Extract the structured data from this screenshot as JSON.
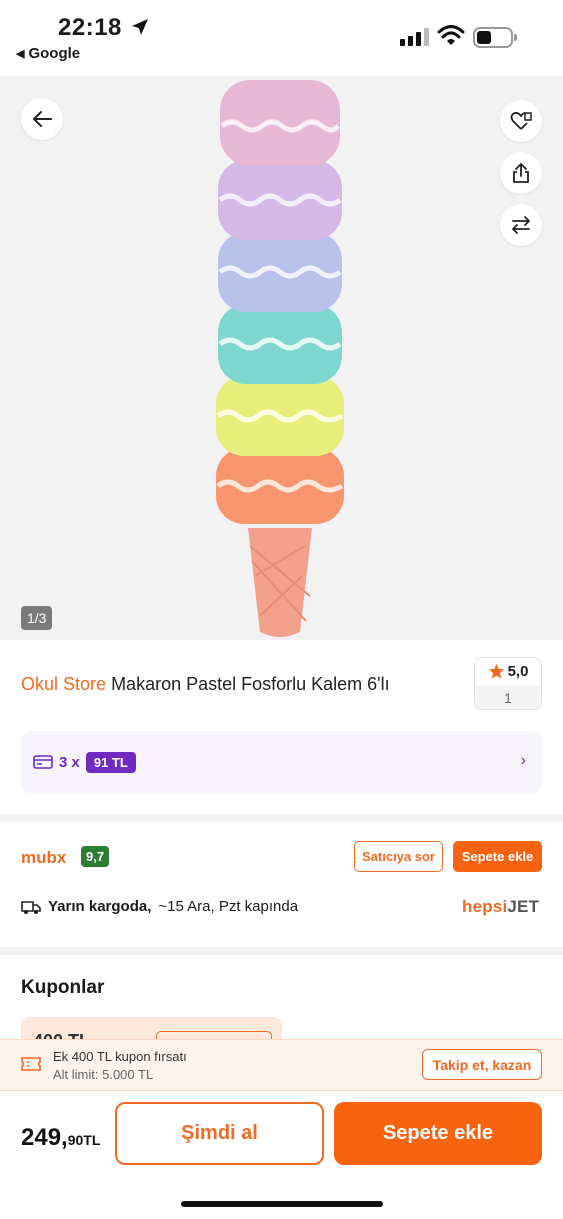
{
  "status_bar": {
    "time": "22:18",
    "back_app": "Google"
  },
  "gallery": {
    "page_indicator": "1/3"
  },
  "product": {
    "store": "Okul Store",
    "name": "Makaron Pastel Fosforlu Kalem 6'lı",
    "rating": "5,0",
    "review_count": "1"
  },
  "installment": {
    "prefix": "3 x",
    "amount": "91 TL"
  },
  "seller": {
    "name": "mubx",
    "score": "9,7",
    "ask_label": "Satıcıya sor",
    "add_label": "Sepete ekle"
  },
  "shipping": {
    "bold": "Yarın kargoda,",
    "rest": "~15 Ara, Pzt kapında",
    "carrier_prefix": "hepsi",
    "carrier_suffix": "JET"
  },
  "coupons": {
    "title": "Kuponlar",
    "card_amount": "400 TL"
  },
  "coupon_banner": {
    "title": "Ek 400 TL kupon fırsatı",
    "subtitle": "Alt limit: 5.000 TL",
    "button": "Takip et, kazan"
  },
  "bottom_bar": {
    "price_int": "249,",
    "price_dec": "90TL",
    "buy_now": "Şimdi al",
    "add_to_cart": "Sepete ekle"
  },
  "colors": {
    "accent": "#f16a21",
    "cta": "#f8630f",
    "installment": "#6f2bbf",
    "score": "#2e7d32"
  }
}
